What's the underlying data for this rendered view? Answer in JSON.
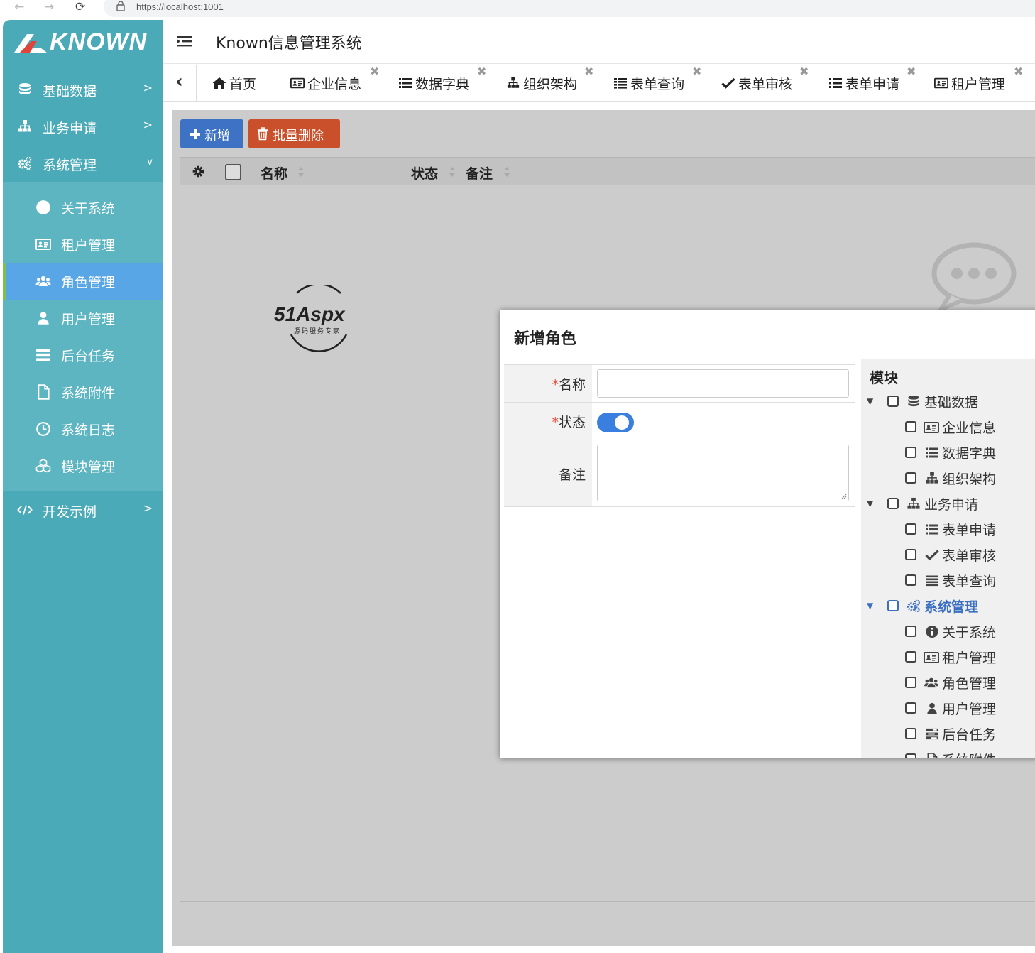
{
  "browser": {
    "url": "https://localhost:1001"
  },
  "sidebar": {
    "logo": "KNOWN",
    "menu": [
      {
        "label": "基础数据",
        "icon": "database-icon",
        "arrow": ">"
      },
      {
        "label": "业务申请",
        "icon": "sitemap-icon",
        "arrow": ">"
      },
      {
        "label": "系统管理",
        "icon": "gears-icon",
        "arrow": "v"
      }
    ],
    "submenu": [
      {
        "label": "关于系统",
        "icon": "info-icon"
      },
      {
        "label": "租户管理",
        "icon": "id-card-icon"
      },
      {
        "label": "角色管理",
        "icon": "users-icon",
        "active": true
      },
      {
        "label": "用户管理",
        "icon": "user-icon"
      },
      {
        "label": "后台任务",
        "icon": "tasks-icon"
      },
      {
        "label": "系统附件",
        "icon": "file-icon"
      },
      {
        "label": "系统日志",
        "icon": "clock-icon"
      },
      {
        "label": "模块管理",
        "icon": "cubes-icon"
      }
    ],
    "footer_menu": {
      "label": "开发示例",
      "icon": "code-icon",
      "arrow": ">"
    }
  },
  "header": {
    "title": "Known信息管理系统"
  },
  "tabs": [
    {
      "label": "首页",
      "icon": "home-icon",
      "closable": false
    },
    {
      "label": "企业信息",
      "icon": "id-card-icon",
      "closable": true
    },
    {
      "label": "数据字典",
      "icon": "list-icon",
      "closable": true
    },
    {
      "label": "组织架构",
      "icon": "sitemap-icon",
      "closable": true
    },
    {
      "label": "表单查询",
      "icon": "list-alt-icon",
      "closable": true
    },
    {
      "label": "表单审核",
      "icon": "check-icon",
      "closable": true
    },
    {
      "label": "表单申请",
      "icon": "list-icon",
      "closable": true
    },
    {
      "label": "租户管理",
      "icon": "id-card-icon",
      "closable": true
    }
  ],
  "toolbar": {
    "add": "新增",
    "batch_delete": "批量删除"
  },
  "table": {
    "columns": [
      "名称",
      "状态",
      "备注"
    ]
  },
  "dialog": {
    "title": "新增角色",
    "fields": {
      "name_label": "名称",
      "status_label": "状态",
      "remark_label": "备注",
      "required_mark": "*"
    },
    "module_title": "模块",
    "tree": [
      {
        "label": "基础数据",
        "icon": "database-icon",
        "level": 0,
        "expanded": true
      },
      {
        "label": "企业信息",
        "icon": "id-card-icon",
        "level": 1
      },
      {
        "label": "数据字典",
        "icon": "list-icon",
        "level": 1
      },
      {
        "label": "组织架构",
        "icon": "sitemap-icon",
        "level": 1
      },
      {
        "label": "业务申请",
        "icon": "sitemap-icon",
        "level": 0,
        "expanded": true
      },
      {
        "label": "表单申请",
        "icon": "list-icon",
        "level": 1
      },
      {
        "label": "表单审核",
        "icon": "check-icon",
        "level": 1
      },
      {
        "label": "表单查询",
        "icon": "list-alt-icon",
        "level": 1
      },
      {
        "label": "系统管理",
        "icon": "gears-icon",
        "level": 0,
        "expanded": true,
        "highlight": true
      },
      {
        "label": "关于系统",
        "icon": "info-icon",
        "level": 1
      },
      {
        "label": "租户管理",
        "icon": "id-card-icon",
        "level": 1
      },
      {
        "label": "角色管理",
        "icon": "users-icon",
        "level": 1
      },
      {
        "label": "用户管理",
        "icon": "user-icon",
        "level": 1
      },
      {
        "label": "后台任务",
        "icon": "tasks-icon",
        "level": 1
      },
      {
        "label": "系统附件",
        "icon": "file-icon",
        "level": 1
      }
    ]
  },
  "watermark": {
    "brand": "51Aspx",
    "tagline": "源码服务专家"
  },
  "colors": {
    "sidebar": "#4aaab8",
    "submenu": "#5db5c1",
    "active": "#58a6e6",
    "primary": "#3a7ee0",
    "danger": "#c9502a"
  }
}
